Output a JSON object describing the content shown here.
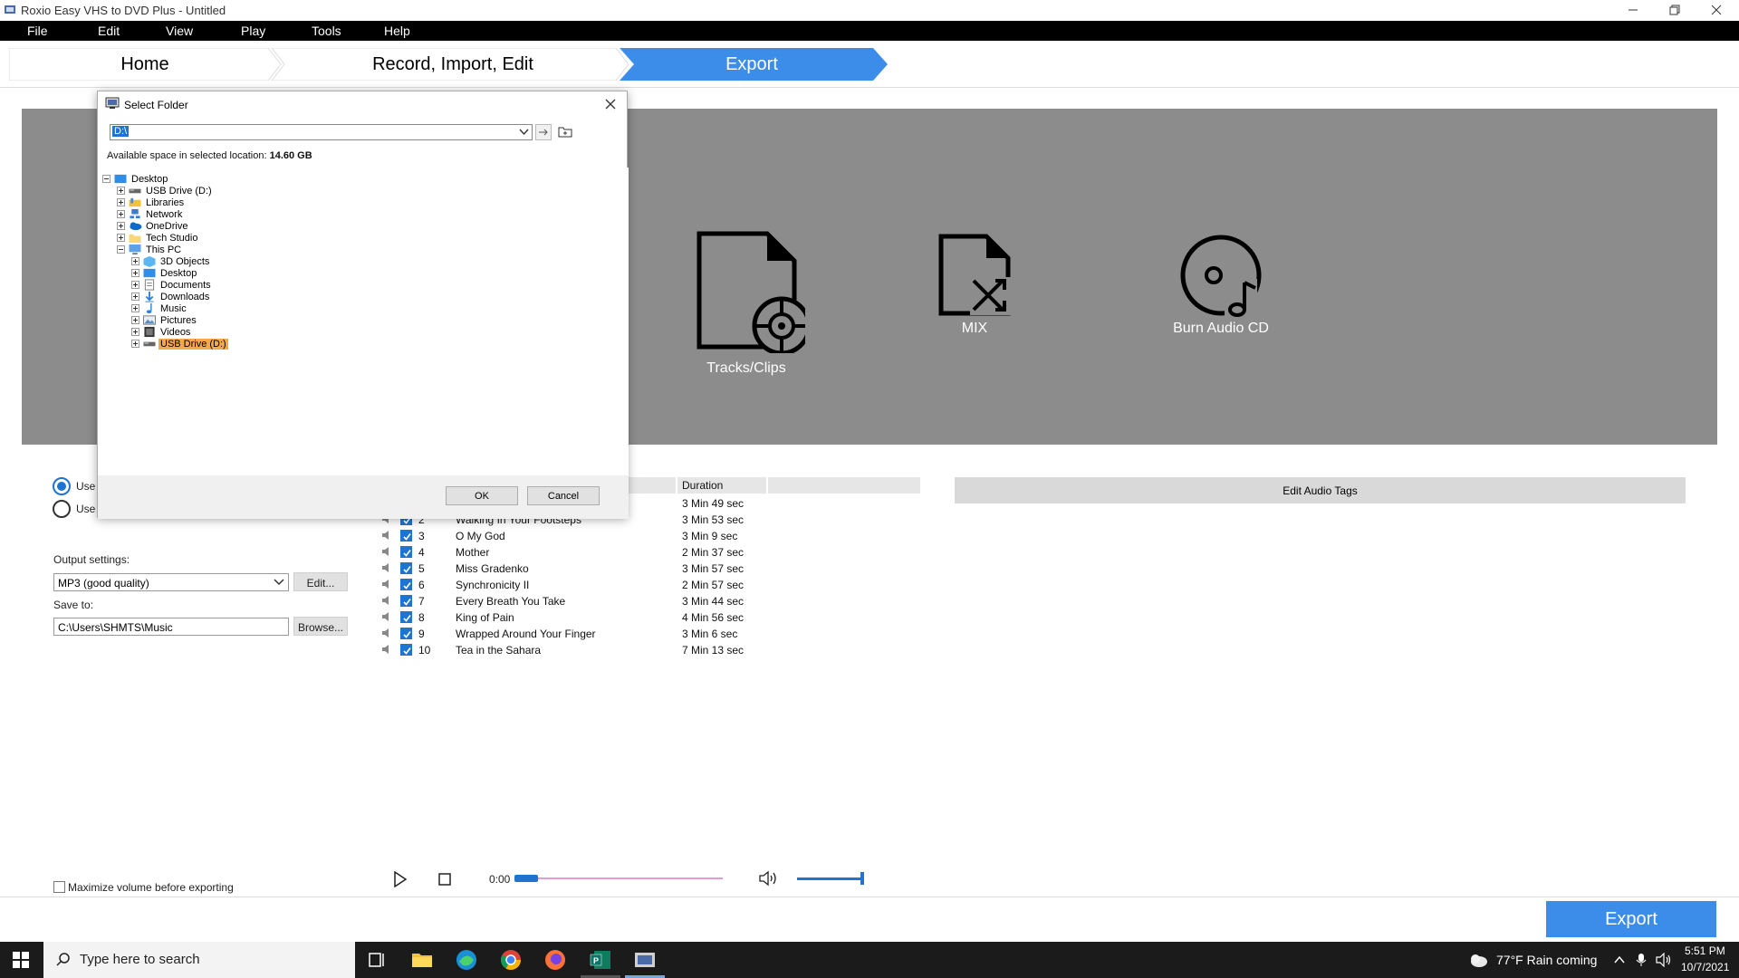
{
  "window": {
    "title": "Roxio Easy VHS to DVD Plus - Untitled"
  },
  "menu": [
    "File",
    "Edit",
    "View",
    "Play",
    "Tools",
    "Help"
  ],
  "workflow": {
    "home": "Home",
    "record": "Record, Import, Edit",
    "export": "Export"
  },
  "export_options": {
    "tracks": "Tracks/Clips",
    "mix": "MIX",
    "burn": "Burn Audio CD"
  },
  "left_panel": {
    "radio1": "Use",
    "radio2": "Use",
    "output_settings_label": "Output settings:",
    "output_settings_value": "MP3 (good quality)",
    "edit_button": "Edit...",
    "save_to_label": "Save to:",
    "save_to_value": "C:\\Users\\SHMTS\\Music",
    "browse_button": "Browse...",
    "maximize_label": "Maximize volume before exporting"
  },
  "tracks": {
    "duration_header": "Duration",
    "rows": [
      {
        "num": "",
        "title": "",
        "duration": "3 Min 49 sec"
      },
      {
        "num": "2",
        "title": "Walking In Your Footsteps",
        "duration": "3 Min 53 sec"
      },
      {
        "num": "3",
        "title": "O My God",
        "duration": "3 Min 9 sec"
      },
      {
        "num": "4",
        "title": "Mother",
        "duration": "2 Min 37 sec"
      },
      {
        "num": "5",
        "title": "Miss Gradenko",
        "duration": "3 Min 57 sec"
      },
      {
        "num": "6",
        "title": "Synchronicity II",
        "duration": "2 Min 57 sec"
      },
      {
        "num": "7",
        "title": "Every Breath You Take",
        "duration": "3 Min 44 sec"
      },
      {
        "num": "8",
        "title": "King of Pain",
        "duration": "4 Min 56 sec"
      },
      {
        "num": "9",
        "title": "Wrapped Around Your Finger",
        "duration": "3 Min 6 sec"
      },
      {
        "num": "10",
        "title": "Tea in the Sahara",
        "duration": "7 Min 13 sec"
      }
    ]
  },
  "edit_tags": "Edit Audio Tags",
  "player": {
    "time": "0:00"
  },
  "export_button": "Export",
  "dialog": {
    "title": "Select Folder",
    "path": "D:\\",
    "available_label": "Available space in selected location:",
    "available_value": "14.60 GB",
    "ok": "OK",
    "cancel": "Cancel",
    "tree": [
      {
        "label": "Desktop",
        "level": 0,
        "icon": "desktop-folder-icon",
        "expanded": true
      },
      {
        "label": "USB Drive (D:)",
        "level": 1,
        "icon": "drive-icon"
      },
      {
        "label": "Libraries",
        "level": 1,
        "icon": "libraries-icon"
      },
      {
        "label": "Network",
        "level": 1,
        "icon": "network-icon"
      },
      {
        "label": "OneDrive",
        "level": 1,
        "icon": "onedrive-icon"
      },
      {
        "label": "Tech Studio",
        "level": 1,
        "icon": "folder-icon"
      },
      {
        "label": "This PC",
        "level": 1,
        "icon": "computer-icon",
        "expanded": true
      },
      {
        "label": "3D Objects",
        "level": 2,
        "icon": "3d-objects-icon"
      },
      {
        "label": "Desktop",
        "level": 2,
        "icon": "desktop-folder-icon"
      },
      {
        "label": "Documents",
        "level": 2,
        "icon": "documents-icon"
      },
      {
        "label": "Downloads",
        "level": 2,
        "icon": "downloads-icon"
      },
      {
        "label": "Music",
        "level": 2,
        "icon": "music-icon"
      },
      {
        "label": "Pictures",
        "level": 2,
        "icon": "pictures-icon"
      },
      {
        "label": "Videos",
        "level": 2,
        "icon": "videos-icon"
      },
      {
        "label": "USB Drive (D:)",
        "level": 2,
        "icon": "drive-icon",
        "selected": true
      }
    ]
  },
  "taskbar": {
    "search_placeholder": "Type here to search",
    "weather": "77°F  Rain coming",
    "time": "5:51 PM",
    "date": "10/7/2021"
  },
  "colors": {
    "accent": "#1e74d0",
    "export_blue": "#3c8cea",
    "gray_area": "#8c8c8c",
    "selected_highlight": "#f5a84a"
  }
}
